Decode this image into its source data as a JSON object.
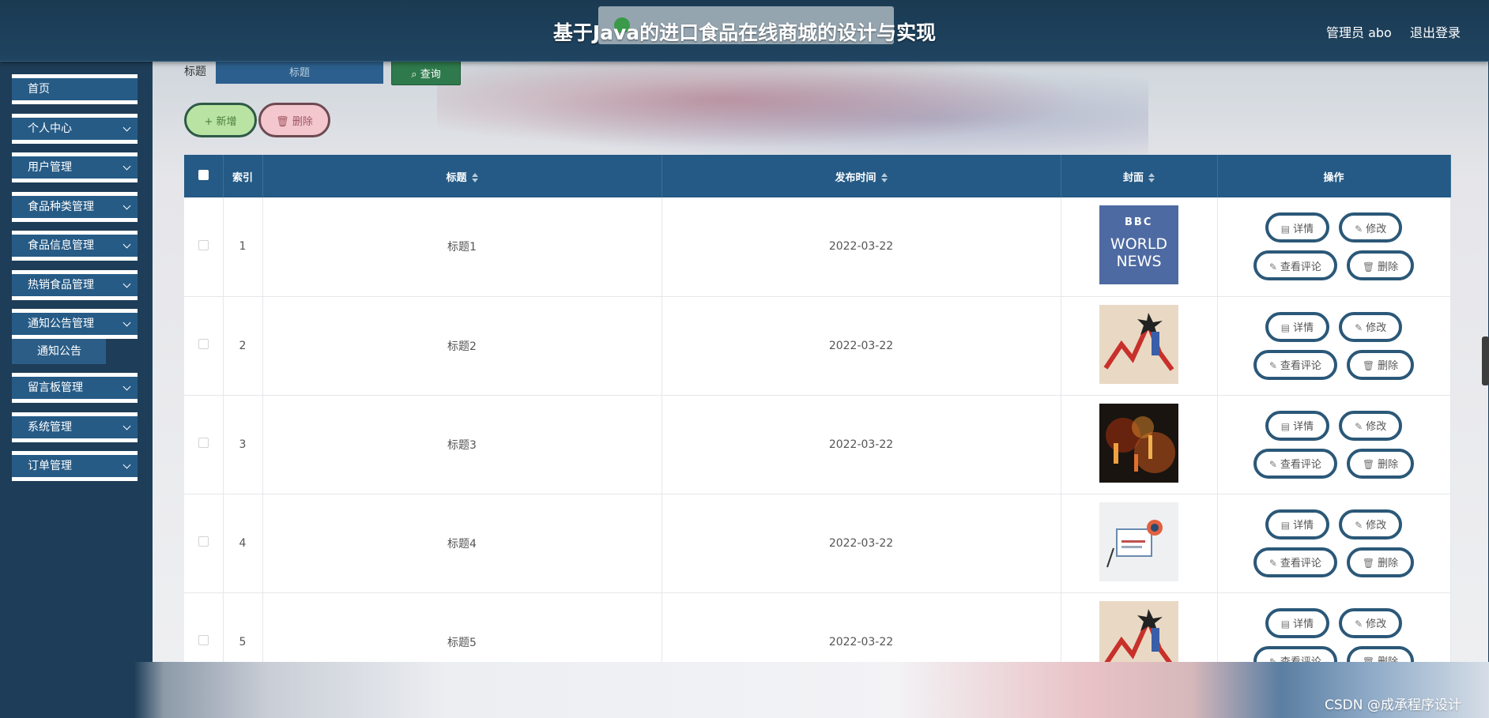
{
  "header": {
    "title": "基于Java的进口食品在线商城的设计与实现",
    "user": "管理员 abo",
    "logout": "退出登录"
  },
  "sidebar": {
    "items": [
      {
        "label": "首页",
        "has_children": false
      },
      {
        "label": "个人中心",
        "has_children": true
      },
      {
        "label": "用户管理",
        "has_children": true
      },
      {
        "label": "食品种类管理",
        "has_children": true
      },
      {
        "label": "食品信息管理",
        "has_children": true
      },
      {
        "label": "热销食品管理",
        "has_children": true
      },
      {
        "label": "通知公告管理",
        "has_children": true
      },
      {
        "label": "留言板管理",
        "has_children": true
      },
      {
        "label": "系统管理",
        "has_children": true
      },
      {
        "label": "订单管理",
        "has_children": true
      }
    ],
    "submenu": {
      "label": "通知公告"
    }
  },
  "search": {
    "label": "标题",
    "placeholder": "标题",
    "query_label": "查询"
  },
  "actions": {
    "add_label": "新增",
    "delete_label": "删除"
  },
  "table": {
    "columns": [
      "索引",
      "标题",
      "发布时间",
      "封面",
      "操作"
    ],
    "rows": [
      {
        "index": "1",
        "title": "标题1",
        "date": "2022-03-22",
        "cover": "bbc-world-news-image",
        "cover_text": {
          "line1": "BBC",
          "line2": "WORLD",
          "line3": "NEWS"
        }
      },
      {
        "index": "2",
        "title": "标题2",
        "date": "2022-03-22",
        "cover": "stock-chart-image"
      },
      {
        "index": "3",
        "title": "标题3",
        "date": "2022-03-22",
        "cover": "currency-symbols-image"
      },
      {
        "index": "4",
        "title": "标题4",
        "date": "2022-03-22",
        "cover": "news-illustration-image"
      },
      {
        "index": "5",
        "title": "标题5",
        "date": "2022-03-22",
        "cover": "stock-chart-image"
      }
    ],
    "row_actions": {
      "detail": "详情",
      "edit": "修改",
      "comments": "查看评论",
      "delete": "删除"
    }
  },
  "watermark": "CSDN @成承程序设计",
  "colors": {
    "header_bg": "#1b3a52",
    "menu_bg": "#265b86",
    "table_header": "#245a85",
    "query_btn": "#2f7a4c",
    "add_btn": "#b9e3a2",
    "delete_btn": "#f3c7cd"
  }
}
